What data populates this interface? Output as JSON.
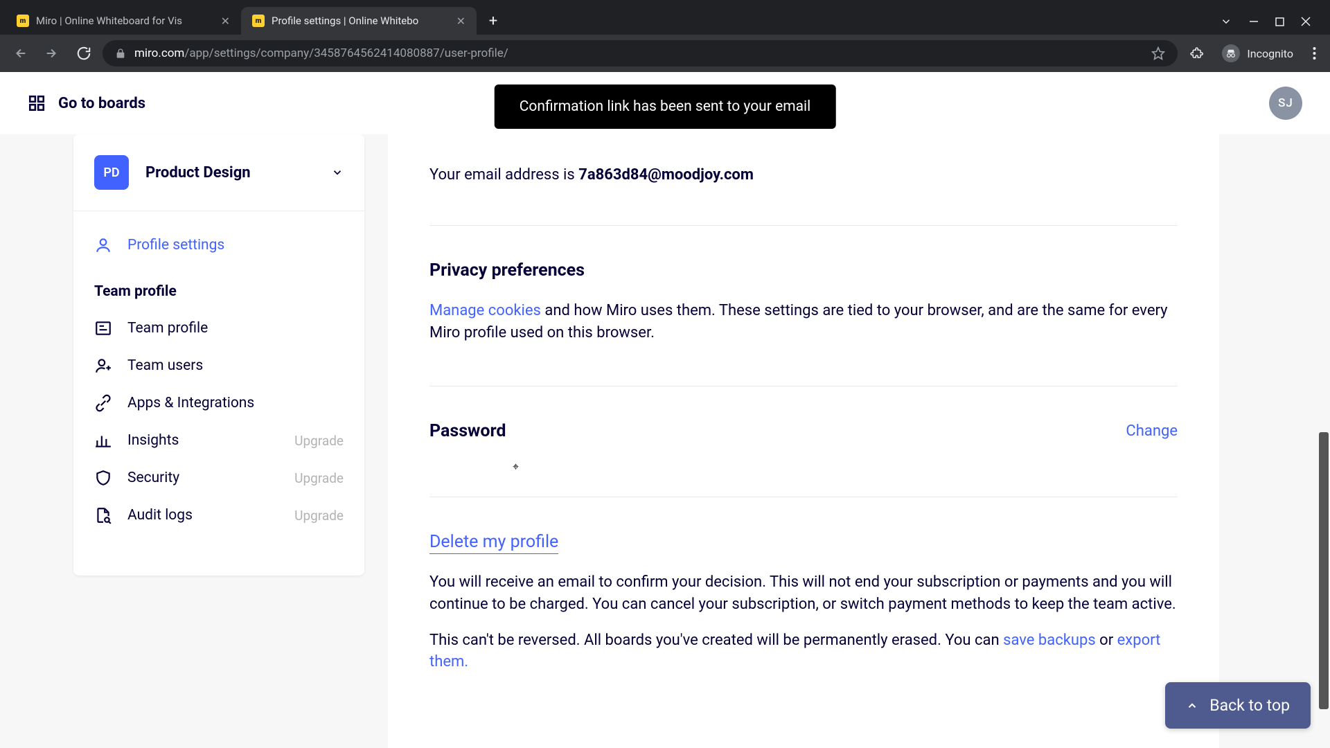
{
  "browser": {
    "tabs": [
      {
        "title": "Miro | Online Whiteboard for Vis"
      },
      {
        "title": "Profile settings | Online Whitebo"
      }
    ],
    "url_domain": "miro.com",
    "url_path": "/app/settings/company/3458764562414080887/user-profile/",
    "incognito_label": "Incognito"
  },
  "toast": "Confirmation link has been sent to your email",
  "header": {
    "go_boards": "Go to boards",
    "avatar_initials": "SJ"
  },
  "sidebar": {
    "team_badge": "PD",
    "team_name": "Product Design",
    "active_item": "Profile settings",
    "section_title": "Team profile",
    "items": [
      {
        "label": "Team profile",
        "upgrade": ""
      },
      {
        "label": "Team users",
        "upgrade": ""
      },
      {
        "label": "Apps & Integrations",
        "upgrade": ""
      },
      {
        "label": "Insights",
        "upgrade": "Upgrade"
      },
      {
        "label": "Security",
        "upgrade": "Upgrade"
      },
      {
        "label": "Audit logs",
        "upgrade": "Upgrade"
      }
    ]
  },
  "content": {
    "email_prefix": "Your email address is ",
    "email_value": "7a863d84@moodjoy.com",
    "privacy_heading": "Privacy preferences",
    "privacy_link": "Manage cookies",
    "privacy_text": " and how Miro uses them. These settings are tied to your browser, and are the same for every Miro profile used on this browser.",
    "password_heading": "Password",
    "password_change": "Change",
    "delete_heading": "Delete my profile",
    "delete_p1": "You will receive an email to confirm your decision. This will not end your subscription or payments and you will continue to be charged. You can cancel your subscription, or switch payment methods to keep the team active.",
    "delete_p2_a": "This can't be reversed. All boards you've created will be permanently erased. You can ",
    "delete_p2_link1": "save backups",
    "delete_p2_b": " or ",
    "delete_p2_link2": "export them."
  },
  "back_to_top": "Back to top"
}
